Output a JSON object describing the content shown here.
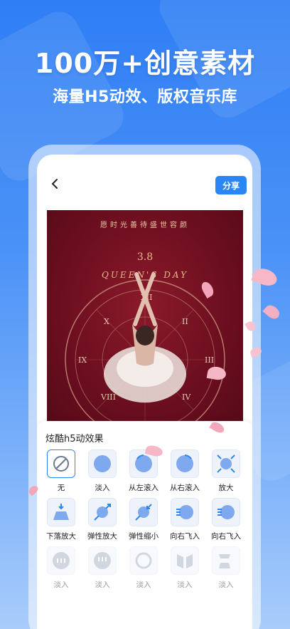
{
  "promo": {
    "headline": "100万+创意素材",
    "subline": "海量H5动效、版权音乐库"
  },
  "editor": {
    "share_label": "分享",
    "poster": {
      "tagline": "愿时光善待盛世容颜",
      "date": "3.8",
      "title": "QUEEN'S DAY"
    },
    "effects_panel": {
      "title": "炫酷h5动效果",
      "row1": [
        {
          "label": "无",
          "icon": "none-icon",
          "selected": true
        },
        {
          "label": "淡入",
          "icon": "fade-in-icon"
        },
        {
          "label": "从左滚入",
          "icon": "roll-in-left-icon"
        },
        {
          "label": "从右滚入",
          "icon": "roll-in-right-icon"
        },
        {
          "label": "放大",
          "icon": "zoom-in-icon"
        }
      ],
      "row2": [
        {
          "label": "下落放大",
          "icon": "drop-zoom-icon"
        },
        {
          "label": "弹性放大",
          "icon": "elastic-zoom-in-icon"
        },
        {
          "label": "弹性缩小",
          "icon": "elastic-zoom-out-icon"
        },
        {
          "label": "向右飞入",
          "icon": "fly-in-right-icon"
        },
        {
          "label": "向右飞入",
          "icon": "fly-in-right-icon"
        }
      ],
      "row3": [
        {
          "label": "淡入",
          "icon": "fade-in-icon"
        },
        {
          "label": "淡入",
          "icon": "fade-in-icon"
        },
        {
          "label": "淡入",
          "icon": "fade-in-icon"
        },
        {
          "label": "淡入",
          "icon": "fade-in-icon"
        },
        {
          "label": "淡入",
          "icon": "fade-in-icon"
        }
      ]
    }
  },
  "colors": {
    "accent": "#2b86f5",
    "background": "#3d88f6",
    "poster_bg": "#6e0f20"
  }
}
